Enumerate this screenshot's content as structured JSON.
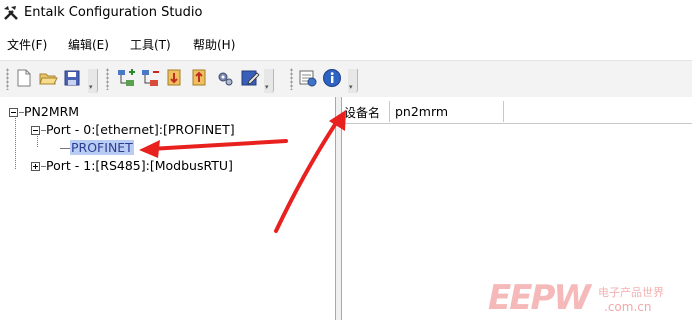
{
  "window": {
    "title": "Entalk Configuration Studio"
  },
  "menu": {
    "items": [
      "文件(F)",
      "编辑(E)",
      "工具(T)",
      "帮助(H)"
    ]
  },
  "toolbar": {
    "groups": [
      [
        "new-file-icon",
        "open-folder-icon",
        "save-icon"
      ],
      [
        "add-node-icon",
        "remove-node-icon",
        "download-icon",
        "upload-icon",
        "settings-icon",
        "edit-icon"
      ],
      [
        "monitor-icon",
        "info-icon"
      ]
    ],
    "overflow_glyph": "▾"
  },
  "tree": {
    "root": "PN2MRM",
    "port0": "Port - 0:[ethernet]:[PROFINET]",
    "port0_child": "PROFINET",
    "port1": "Port - 1:[RS485]:[ModbusRTU]"
  },
  "properties": {
    "rows": [
      {
        "name": "设备名",
        "value": "pn2mrm"
      }
    ]
  },
  "watermark": {
    "logo": "EEPW",
    "cn": "电子产品世界",
    "url": ".com.cn"
  },
  "colors": {
    "selection": "#b9cdf4",
    "annotation_arrow": "#e8201e",
    "watermark": "#f5b9b9"
  }
}
